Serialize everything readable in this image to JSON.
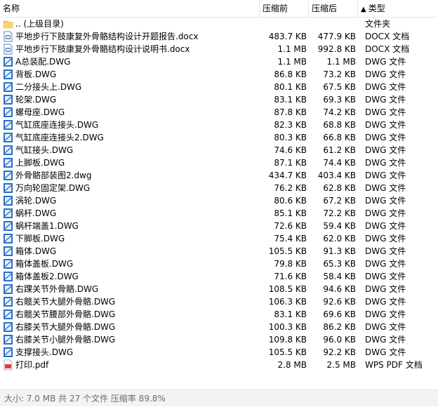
{
  "columns": {
    "name": "名称",
    "size": "压缩前",
    "compressed": "压缩后",
    "type_arrow": "▲",
    "type": "类型"
  },
  "rows": [
    {
      "icon": "folder-icon",
      "name": ".. (上级目录)",
      "size": "",
      "compressed": "",
      "type": "文件夹"
    },
    {
      "icon": "docx-file-icon",
      "name": "平地步行下肢康复外骨骼结构设计开题报告.docx",
      "size": "483.7 KB",
      "compressed": "477.9 KB",
      "type": "DOCX 文档"
    },
    {
      "icon": "docx-file-icon",
      "name": "平地步行下肢康复外骨骼结构设计说明书.docx",
      "size": "1.1 MB",
      "compressed": "992.8 KB",
      "type": "DOCX 文档"
    },
    {
      "icon": "dwg-file-icon",
      "name": "A总装配.DWG",
      "size": "1.1 MB",
      "compressed": "1.1 MB",
      "type": "DWG 文件"
    },
    {
      "icon": "dwg-file-icon",
      "name": "背板.DWG",
      "size": "86.8 KB",
      "compressed": "73.2 KB",
      "type": "DWG 文件"
    },
    {
      "icon": "dwg-file-icon",
      "name": "二分接头上.DWG",
      "size": "80.1 KB",
      "compressed": "67.5 KB",
      "type": "DWG 文件"
    },
    {
      "icon": "dwg-file-icon",
      "name": "轮架.DWG",
      "size": "83.1 KB",
      "compressed": "69.3 KB",
      "type": "DWG 文件"
    },
    {
      "icon": "dwg-file-icon",
      "name": "螺母座.DWG",
      "size": "87.8 KB",
      "compressed": "74.2 KB",
      "type": "DWG 文件"
    },
    {
      "icon": "dwg-file-icon",
      "name": "气缸底座连接头.DWG",
      "size": "82.3 KB",
      "compressed": "68.8 KB",
      "type": "DWG 文件"
    },
    {
      "icon": "dwg-file-icon",
      "name": "气缸底座连接头2.DWG",
      "size": "80.3 KB",
      "compressed": "66.8 KB",
      "type": "DWG 文件"
    },
    {
      "icon": "dwg-file-icon",
      "name": "气缸接头.DWG",
      "size": "74.6 KB",
      "compressed": "61.2 KB",
      "type": "DWG 文件"
    },
    {
      "icon": "dwg-file-icon",
      "name": "上脚板.DWG",
      "size": "87.1 KB",
      "compressed": "74.4 KB",
      "type": "DWG 文件"
    },
    {
      "icon": "dwg-file-icon",
      "name": "外骨骼部装图2.dwg",
      "size": "434.7 KB",
      "compressed": "403.4 KB",
      "type": "DWG 文件"
    },
    {
      "icon": "dwg-file-icon",
      "name": "万向轮固定架.DWG",
      "size": "76.2 KB",
      "compressed": "62.8 KB",
      "type": "DWG 文件"
    },
    {
      "icon": "dwg-file-icon",
      "name": "涡轮.DWG",
      "size": "80.6 KB",
      "compressed": "67.2 KB",
      "type": "DWG 文件"
    },
    {
      "icon": "dwg-file-icon",
      "name": "蜗杆.DWG",
      "size": "85.1 KB",
      "compressed": "72.2 KB",
      "type": "DWG 文件"
    },
    {
      "icon": "dwg-file-icon",
      "name": "蜗杆端盖1.DWG",
      "size": "72.6 KB",
      "compressed": "59.4 KB",
      "type": "DWG 文件"
    },
    {
      "icon": "dwg-file-icon",
      "name": "下脚板.DWG",
      "size": "75.4 KB",
      "compressed": "62.0 KB",
      "type": "DWG 文件"
    },
    {
      "icon": "dwg-file-icon",
      "name": "箱体.DWG",
      "size": "105.5 KB",
      "compressed": "91.3 KB",
      "type": "DWG 文件"
    },
    {
      "icon": "dwg-file-icon",
      "name": "箱体盖板.DWG",
      "size": "79.8 KB",
      "compressed": "65.3 KB",
      "type": "DWG 文件"
    },
    {
      "icon": "dwg-file-icon",
      "name": "箱体盖板2.DWG",
      "size": "71.6 KB",
      "compressed": "58.4 KB",
      "type": "DWG 文件"
    },
    {
      "icon": "dwg-file-icon",
      "name": "右踝关节外骨骼.DWG",
      "size": "108.5 KB",
      "compressed": "94.6 KB",
      "type": "DWG 文件"
    },
    {
      "icon": "dwg-file-icon",
      "name": "右髋关节大腿外骨骼.DWG",
      "size": "106.3 KB",
      "compressed": "92.6 KB",
      "type": "DWG 文件"
    },
    {
      "icon": "dwg-file-icon",
      "name": "右髋关节腰部外骨骼.DWG",
      "size": "83.1 KB",
      "compressed": "69.6 KB",
      "type": "DWG 文件"
    },
    {
      "icon": "dwg-file-icon",
      "name": "右膝关节大腿外骨骼.DWG",
      "size": "100.3 KB",
      "compressed": "86.2 KB",
      "type": "DWG 文件"
    },
    {
      "icon": "dwg-file-icon",
      "name": "右膝关节小腿外骨骼.DWG",
      "size": "109.8 KB",
      "compressed": "96.0 KB",
      "type": "DWG 文件"
    },
    {
      "icon": "dwg-file-icon",
      "name": "支撑接头.DWG",
      "size": "105.5 KB",
      "compressed": "92.2 KB",
      "type": "DWG 文件"
    },
    {
      "icon": "pdf-file-icon",
      "name": "打印.pdf",
      "size": "2.8 MB",
      "compressed": "2.5 MB",
      "type": "WPS PDF 文档"
    }
  ],
  "status": "大小: 7.0 MB 共 27 个文件 压缩率 89.8%",
  "colors": {
    "folder": "#f2c94c",
    "dwg": "#2a6fc9",
    "docx": "#5a7fb8",
    "pdf": "#d9413a",
    "status_text": "#6d6d6d"
  }
}
